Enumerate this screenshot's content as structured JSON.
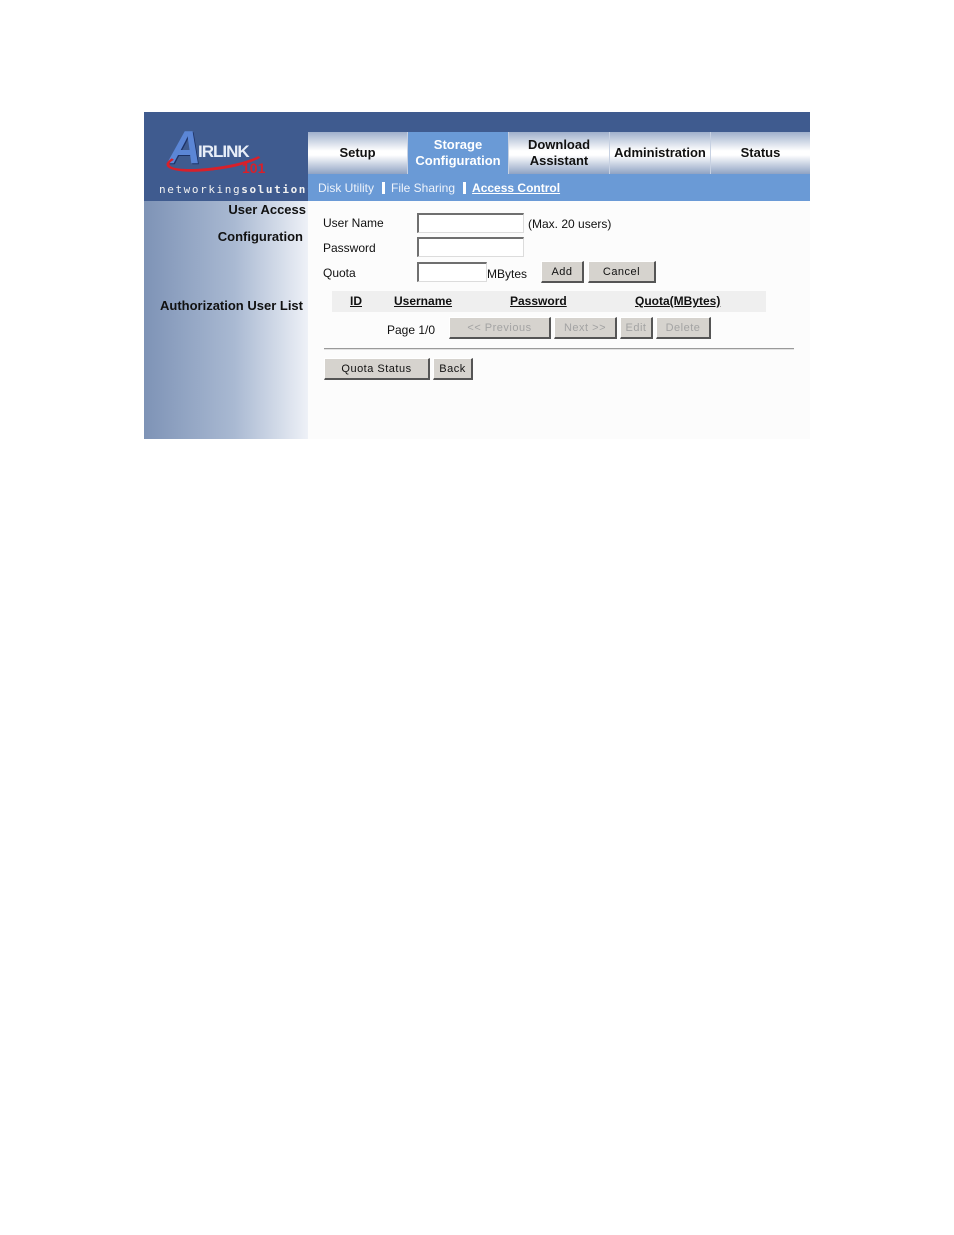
{
  "brand": {
    "logo_text_a": "A",
    "logo_text_rest": "IRLINK",
    "logo_number": "101",
    "tagline_light": "networking",
    "tagline_bold": "solutions"
  },
  "nav": {
    "tabs": [
      {
        "label_line1": "Setup",
        "label_line2": "",
        "active": false
      },
      {
        "label_line1": "Storage",
        "label_line2": "Configuration",
        "active": true
      },
      {
        "label_line1": "Download",
        "label_line2": "Assistant",
        "active": false
      },
      {
        "label_line1": "Administration",
        "label_line2": "",
        "active": false
      },
      {
        "label_line1": "Status",
        "label_line2": "",
        "active": false
      }
    ],
    "subtabs": [
      {
        "label": "Disk Utility",
        "active": false
      },
      {
        "label": "File Sharing",
        "active": false
      },
      {
        "label": "Access Control",
        "active": true
      }
    ]
  },
  "sidebar": {
    "section1_line1": "User Access",
    "section1_line2": "Configuration",
    "section2": "Authorization User List"
  },
  "form": {
    "username_label": "User Name",
    "username_value": "",
    "username_hint": "(Max. 20 users)",
    "password_label": "Password",
    "password_value": "",
    "quota_label": "Quota",
    "quota_value": "",
    "quota_unit": "MBytes",
    "add_label": "Add",
    "cancel_label": "Cancel"
  },
  "user_list": {
    "columns": [
      "ID",
      "Username",
      "Password",
      "Quota(MBytes)"
    ],
    "rows": [],
    "page_text": "Page 1/0",
    "previous_label": "<< Previous",
    "next_label": "Next >>",
    "edit_label": "Edit",
    "delete_label": "Delete"
  },
  "footer": {
    "quota_status_label": "Quota Status",
    "back_label": "Back"
  }
}
